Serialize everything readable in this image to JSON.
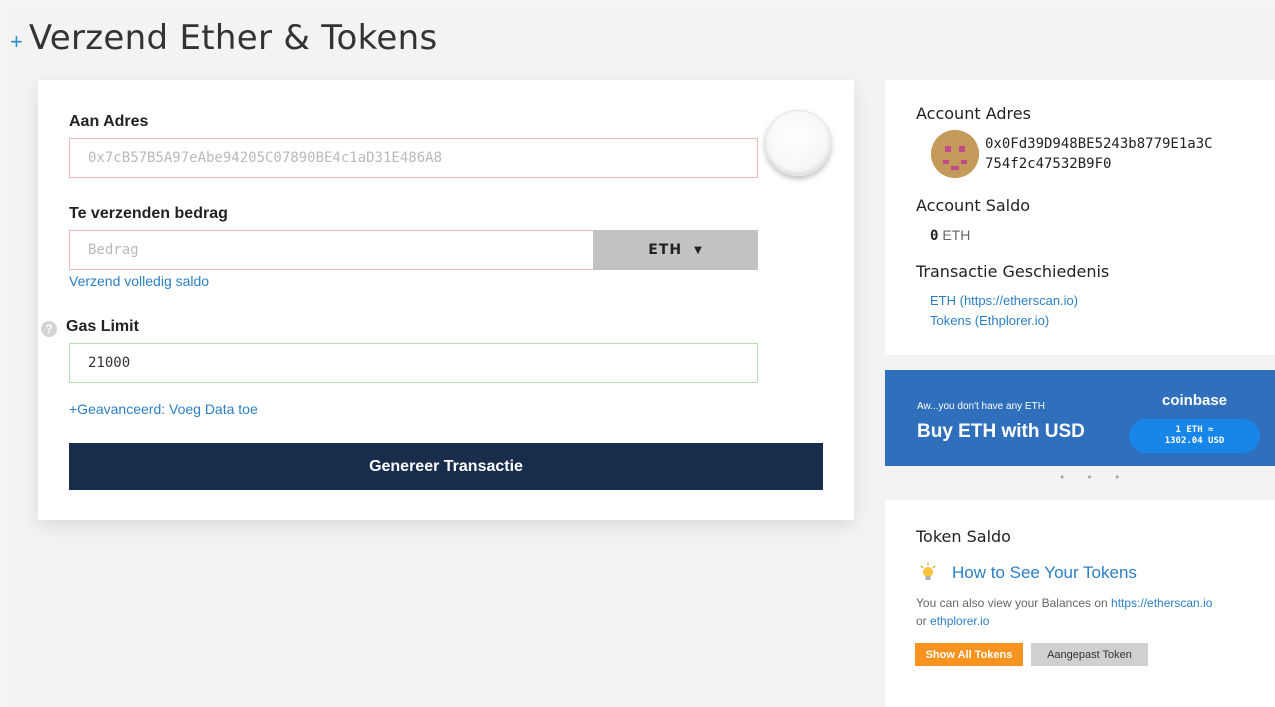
{
  "header": {
    "plus": "+",
    "title": "Verzend Ether & Tokens"
  },
  "form": {
    "to_address_label": "Aan Adres",
    "to_address_value": "0x7cB57B5A97eAbe94205C07890BE4c1aD31E486A8",
    "amount_label": "Te verzenden bedrag",
    "amount_placeholder": "Bedrag",
    "currency": "ETH",
    "send_full_balance_link": "Verzend volledig saldo",
    "gas_limit_label": "Gas Limit",
    "gas_limit_value": "21000",
    "help_icon": "?",
    "advanced_link": "+Geavanceerd: Voeg Data toe",
    "generate_button": "Genereer Transactie"
  },
  "account": {
    "address_title": "Account Adres",
    "address_line1": "0x0Fd39D948BE5243b8779E1a3C",
    "address_line2": "754f2c47532B9F0",
    "balance_title": "Account Saldo",
    "balance_value": "0",
    "balance_unit": "ETH",
    "history_title": "Transactie Geschiedenis",
    "history_eth_link": "ETH (https://etherscan.io)",
    "history_tokens_link": "Tokens (Ethplorer.io)"
  },
  "coinbase": {
    "subtitle": "Aw...you don't have any ETH",
    "headline": "Buy ETH with USD",
    "brand": "coinbase",
    "rate_line1": "1 ETH ≈",
    "rate_line2": "1302.04 USD",
    "dots": "• • •"
  },
  "tokens": {
    "title": "Token Saldo",
    "how_to_link": "How to See Your Tokens",
    "desc_prefix": "You can also view your Balances on ",
    "desc_link1": "https://etherscan.io",
    "desc_middle": "or ",
    "desc_link2": "ethplorer.io",
    "show_all_button": "Show All Tokens",
    "custom_token_button": "Aangepast Token"
  },
  "colors": {
    "accent_blue": "#2b7fc4",
    "generate_button_bg": "#182d4b",
    "coinbase_bg": "#2f6fbb",
    "show_all_bg": "#f7931e"
  },
  "icons": {
    "help": "question-circle-icon",
    "caret": "caret-down-icon",
    "bulb": "lightbulb-icon",
    "identicon": "identicon-avatar"
  }
}
